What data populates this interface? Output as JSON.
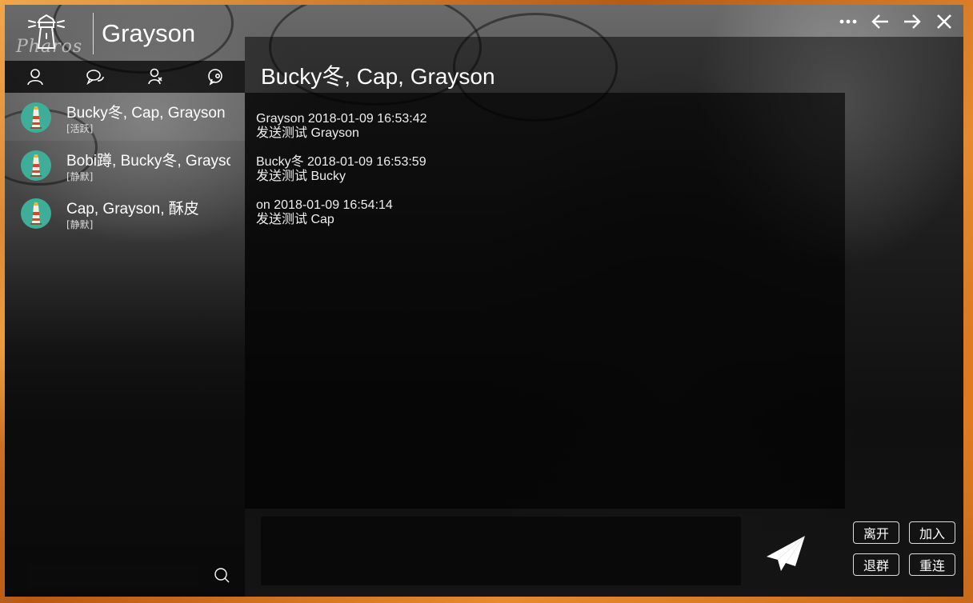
{
  "app": {
    "logo_text": "Pharos",
    "user_name": "Grayson"
  },
  "window_controls": [
    {
      "name": "more-icon"
    },
    {
      "name": "back-arrow-icon"
    },
    {
      "name": "forward-arrow-icon"
    },
    {
      "name": "close-icon"
    }
  ],
  "sidebar": {
    "tabs": [
      {
        "name": "user-icon"
      },
      {
        "name": "chat-bubbles-icon"
      },
      {
        "name": "contacts-icon"
      },
      {
        "name": "group-chat-icon"
      }
    ],
    "conversations": [
      {
        "title": "Bucky冬, Cap, Grayson",
        "status": "[活跃]"
      },
      {
        "title": "Bobi蹲, Bucky冬, Grayson",
        "status": "[静默]"
      },
      {
        "title": "Cap, Grayson, 酥皮",
        "status": "[静默]"
      }
    ],
    "search": {
      "placeholder": ""
    }
  },
  "chat": {
    "title": "Bucky冬, Cap, Grayson",
    "messages": [
      {
        "meta": "Grayson 2018-01-09 16:53:42",
        "body": "发送测试 Grayson"
      },
      {
        "meta": "Bucky冬 2018-01-09 16:53:59",
        "body": "发送测试 Bucky"
      },
      {
        "meta": "on 2018-01-09 16:54:14",
        "body": "发送测试 Cap"
      }
    ],
    "composer": {
      "value": ""
    },
    "actions": {
      "leave": "离开",
      "join": "加入",
      "quit_group": "退群",
      "reconnect": "重连"
    }
  },
  "colors": {
    "avatar_bg": "#3fae98",
    "frame": "#d9822b"
  }
}
